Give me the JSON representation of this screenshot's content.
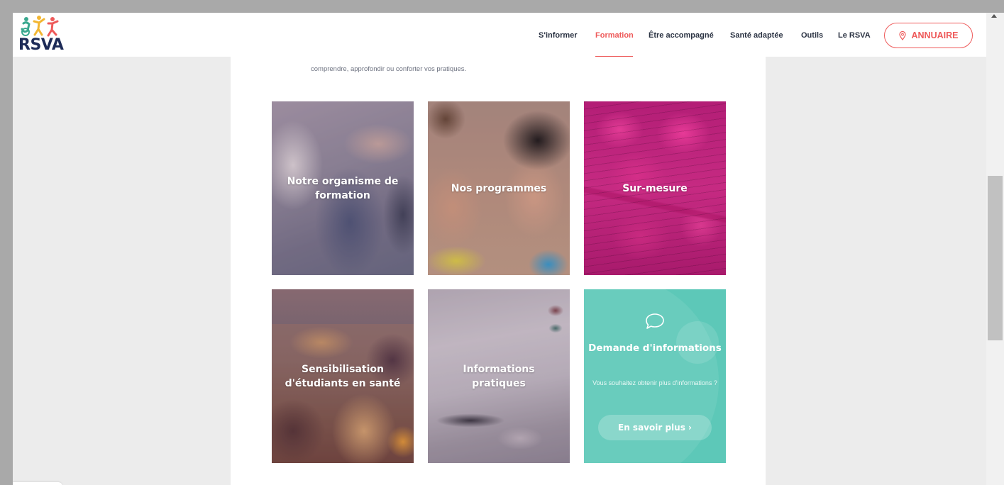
{
  "logo": {
    "text": "RSVA"
  },
  "nav": {
    "items": [
      {
        "label": "S'informer",
        "active": false
      },
      {
        "label": "Formation",
        "active": true
      },
      {
        "label": "Être accompagné",
        "active": false
      },
      {
        "label": "Santé adaptée",
        "active": false
      },
      {
        "label": "Outils",
        "active": false
      },
      {
        "label": "Le RSVA",
        "active": false
      }
    ],
    "annuaire_label": "ANNUAIRE"
  },
  "main": {
    "intro_text": "comprendre, approfondir ou conforter vos pratiques.",
    "tiles": [
      {
        "label": "Notre organisme de formation"
      },
      {
        "label": "Nos programmes"
      },
      {
        "label": "Sur-mesure"
      },
      {
        "label": "Sensibilisation d'étudiants en santé"
      },
      {
        "label": "Informations pratiques"
      }
    ],
    "info_card": {
      "title": "Demande d'informations",
      "text": "Vous souhaitez obtenir plus d'informations ?",
      "button_label": "En savoir plus ›"
    }
  },
  "colors": {
    "accent": "#ee5a5a",
    "brand_navy": "#1d2b57",
    "teal": "#5dc8b8"
  },
  "icons": [
    "map-pin-icon",
    "chat-bubble-icon",
    "logo-figures-icon"
  ]
}
